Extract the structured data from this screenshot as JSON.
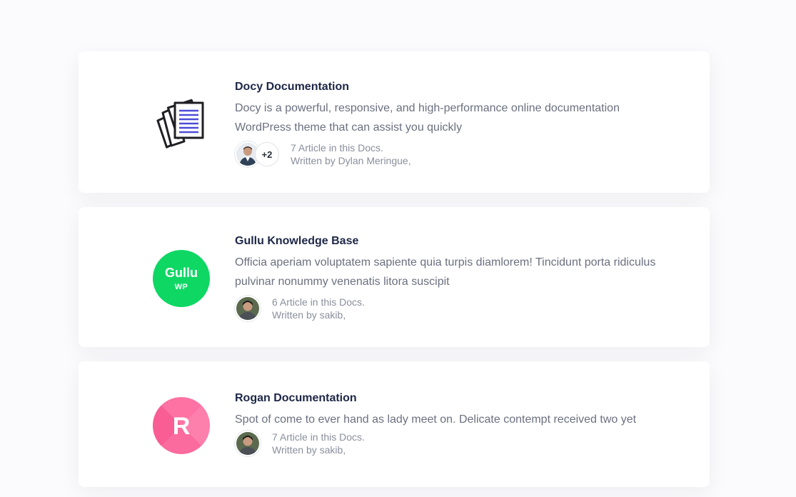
{
  "docs": [
    {
      "title": "Docy Documentation",
      "description": "Docy is a powerful, responsive, and high-performance online documentation WordPress theme that can assist you quickly",
      "articles": "7 Article in this Docs.",
      "author": "Written by Dylan Meringue,",
      "extra_authors": "+2",
      "logo": "documents-icon"
    },
    {
      "title": "Gullu Knowledge Base",
      "description": "Officia aperiam voluptatem sapiente quia turpis diamlorem! Tincidunt porta ridiculus pulvinar nonummy venenatis litora suscipit",
      "articles": "6 Article in this Docs.",
      "author": "Written by sakib,",
      "logo_text": "Gullu",
      "logo_subtext": "WP",
      "logo_color": "#0ed764"
    },
    {
      "title": "Rogan Documentation",
      "description": "Spot of come to ever hand as lady meet on. Delicate contempt received two yet",
      "articles": "7 Article in this Docs.",
      "author": "Written by sakib,",
      "logo_text": "R",
      "logo_color": "#fb6b9d"
    }
  ],
  "colors": {
    "title": "#1d2746",
    "text": "#6b707f",
    "muted": "#8a8f9c",
    "doc_icon_accent": "#4c4cd8"
  }
}
